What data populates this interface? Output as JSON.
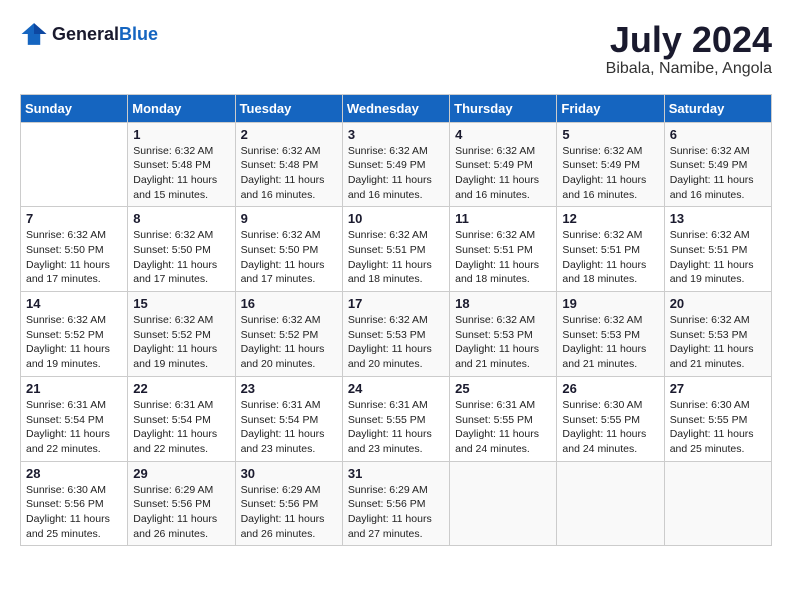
{
  "logo": {
    "general": "General",
    "blue": "Blue"
  },
  "title": {
    "month_year": "July 2024",
    "location": "Bibala, Namibe, Angola"
  },
  "headers": [
    "Sunday",
    "Monday",
    "Tuesday",
    "Wednesday",
    "Thursday",
    "Friday",
    "Saturday"
  ],
  "weeks": [
    [
      {
        "day": "",
        "text": ""
      },
      {
        "day": "1",
        "text": "Sunrise: 6:32 AM\nSunset: 5:48 PM\nDaylight: 11 hours\nand 15 minutes."
      },
      {
        "day": "2",
        "text": "Sunrise: 6:32 AM\nSunset: 5:48 PM\nDaylight: 11 hours\nand 16 minutes."
      },
      {
        "day": "3",
        "text": "Sunrise: 6:32 AM\nSunset: 5:49 PM\nDaylight: 11 hours\nand 16 minutes."
      },
      {
        "day": "4",
        "text": "Sunrise: 6:32 AM\nSunset: 5:49 PM\nDaylight: 11 hours\nand 16 minutes."
      },
      {
        "day": "5",
        "text": "Sunrise: 6:32 AM\nSunset: 5:49 PM\nDaylight: 11 hours\nand 16 minutes."
      },
      {
        "day": "6",
        "text": "Sunrise: 6:32 AM\nSunset: 5:49 PM\nDaylight: 11 hours\nand 16 minutes."
      }
    ],
    [
      {
        "day": "7",
        "text": "Sunrise: 6:32 AM\nSunset: 5:50 PM\nDaylight: 11 hours\nand 17 minutes."
      },
      {
        "day": "8",
        "text": "Sunrise: 6:32 AM\nSunset: 5:50 PM\nDaylight: 11 hours\nand 17 minutes."
      },
      {
        "day": "9",
        "text": "Sunrise: 6:32 AM\nSunset: 5:50 PM\nDaylight: 11 hours\nand 17 minutes."
      },
      {
        "day": "10",
        "text": "Sunrise: 6:32 AM\nSunset: 5:51 PM\nDaylight: 11 hours\nand 18 minutes."
      },
      {
        "day": "11",
        "text": "Sunrise: 6:32 AM\nSunset: 5:51 PM\nDaylight: 11 hours\nand 18 minutes."
      },
      {
        "day": "12",
        "text": "Sunrise: 6:32 AM\nSunset: 5:51 PM\nDaylight: 11 hours\nand 18 minutes."
      },
      {
        "day": "13",
        "text": "Sunrise: 6:32 AM\nSunset: 5:51 PM\nDaylight: 11 hours\nand 19 minutes."
      }
    ],
    [
      {
        "day": "14",
        "text": "Sunrise: 6:32 AM\nSunset: 5:52 PM\nDaylight: 11 hours\nand 19 minutes."
      },
      {
        "day": "15",
        "text": "Sunrise: 6:32 AM\nSunset: 5:52 PM\nDaylight: 11 hours\nand 19 minutes."
      },
      {
        "day": "16",
        "text": "Sunrise: 6:32 AM\nSunset: 5:52 PM\nDaylight: 11 hours\nand 20 minutes."
      },
      {
        "day": "17",
        "text": "Sunrise: 6:32 AM\nSunset: 5:53 PM\nDaylight: 11 hours\nand 20 minutes."
      },
      {
        "day": "18",
        "text": "Sunrise: 6:32 AM\nSunset: 5:53 PM\nDaylight: 11 hours\nand 21 minutes."
      },
      {
        "day": "19",
        "text": "Sunrise: 6:32 AM\nSunset: 5:53 PM\nDaylight: 11 hours\nand 21 minutes."
      },
      {
        "day": "20",
        "text": "Sunrise: 6:32 AM\nSunset: 5:53 PM\nDaylight: 11 hours\nand 21 minutes."
      }
    ],
    [
      {
        "day": "21",
        "text": "Sunrise: 6:31 AM\nSunset: 5:54 PM\nDaylight: 11 hours\nand 22 minutes."
      },
      {
        "day": "22",
        "text": "Sunrise: 6:31 AM\nSunset: 5:54 PM\nDaylight: 11 hours\nand 22 minutes."
      },
      {
        "day": "23",
        "text": "Sunrise: 6:31 AM\nSunset: 5:54 PM\nDaylight: 11 hours\nand 23 minutes."
      },
      {
        "day": "24",
        "text": "Sunrise: 6:31 AM\nSunset: 5:55 PM\nDaylight: 11 hours\nand 23 minutes."
      },
      {
        "day": "25",
        "text": "Sunrise: 6:31 AM\nSunset: 5:55 PM\nDaylight: 11 hours\nand 24 minutes."
      },
      {
        "day": "26",
        "text": "Sunrise: 6:30 AM\nSunset: 5:55 PM\nDaylight: 11 hours\nand 24 minutes."
      },
      {
        "day": "27",
        "text": "Sunrise: 6:30 AM\nSunset: 5:55 PM\nDaylight: 11 hours\nand 25 minutes."
      }
    ],
    [
      {
        "day": "28",
        "text": "Sunrise: 6:30 AM\nSunset: 5:56 PM\nDaylight: 11 hours\nand 25 minutes."
      },
      {
        "day": "29",
        "text": "Sunrise: 6:29 AM\nSunset: 5:56 PM\nDaylight: 11 hours\nand 26 minutes."
      },
      {
        "day": "30",
        "text": "Sunrise: 6:29 AM\nSunset: 5:56 PM\nDaylight: 11 hours\nand 26 minutes."
      },
      {
        "day": "31",
        "text": "Sunrise: 6:29 AM\nSunset: 5:56 PM\nDaylight: 11 hours\nand 27 minutes."
      },
      {
        "day": "",
        "text": ""
      },
      {
        "day": "",
        "text": ""
      },
      {
        "day": "",
        "text": ""
      }
    ]
  ]
}
